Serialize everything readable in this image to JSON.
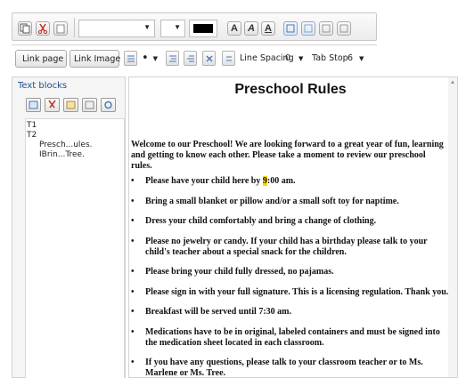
{
  "toolbar": {
    "bold_label": "A",
    "italic_label": "A",
    "underline_label": "A",
    "font_color": "#000000"
  },
  "format_bar": {
    "link_page_label": "Link page",
    "link_image_left_label": "Link Image left",
    "bullet_glyph": "•",
    "line_spacing_label": "Line Spacing",
    "line_spacing_value": "0",
    "tab_stop_label": "Tab Stop",
    "tab_stop_value": "6"
  },
  "left_panel": {
    "title": "Text blocks",
    "tree": [
      "T1",
      "T2",
      "Presch...ules.",
      "IBrin...Tree."
    ]
  },
  "document": {
    "title": "Preschool Rules",
    "intro": "Welcome to our Preschool! We are looking forward to a great year of fun, learning and getting to know each other. Please take a moment to review our preschool rules.",
    "first_rule": {
      "before": "Please have your child here by ",
      "highlight": "9",
      "after": ":00 am."
    },
    "rules": [
      "Bring a small blanket or pillow and/or a small soft toy for naptime.",
      "Dress your child comfortably and bring a change of clothing.",
      "Please no jewelry or candy. If your child has a birthday please talk to your child's teacher about a special snack for the children.",
      "Please bring your child fully dressed, no pajamas.",
      "Please sign in with your full signature. This is a licensing regulation. Thank you.",
      "Breakfast will be served until 7:30 am.",
      "Medications have to be in original, labeled containers and must be signed into the medication sheet located in each classroom.",
      "If you have any questions, please talk to your classroom teacher or to Ms. Marlene or Ms. Tree."
    ],
    "highlight_color": "#ffd800"
  }
}
